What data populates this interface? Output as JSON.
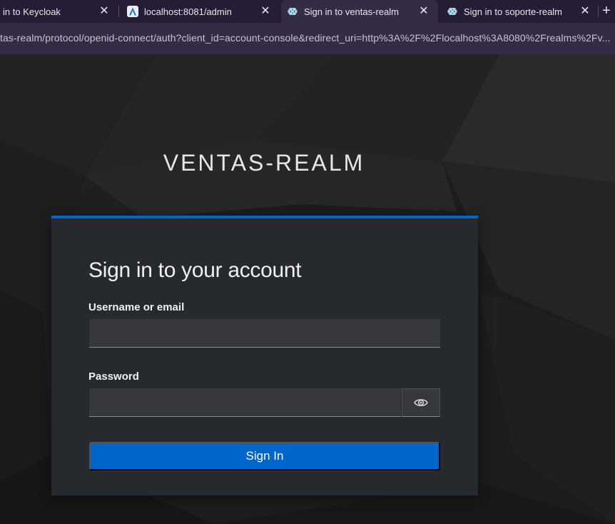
{
  "browser": {
    "tabs": [
      {
        "label": "in to Keycloak",
        "icon": "keycloak-favicon-icon",
        "active": false
      },
      {
        "label": "localhost:8081/admin",
        "icon": "admin-favicon-icon",
        "active": false
      },
      {
        "label": "Sign in to ventas-realm",
        "icon": "keycloak-favicon-icon",
        "active": true
      },
      {
        "label": "Sign in to soporte-realm",
        "icon": "keycloak-favicon-icon",
        "active": false
      }
    ],
    "close_glyph": "✕",
    "new_tab_glyph": "+",
    "url": "tas-realm/protocol/openid-connect/auth?client_id=account-console&redirect_uri=http%3A%2F%2Flocalhost%3A8080%2Frealms%2Fv..."
  },
  "login": {
    "realm_title": "VENTAS-REALM",
    "card_title": "Sign in to your account",
    "username_label": "Username or email",
    "username_value": "",
    "password_label": "Password",
    "password_value": "",
    "show_password_icon": "eye-icon",
    "submit_label": "Sign In"
  },
  "colors": {
    "accent": "#0066cc",
    "card_bg": "#26292d",
    "input_bg": "#36383c",
    "tab_bar": "#241d33"
  }
}
